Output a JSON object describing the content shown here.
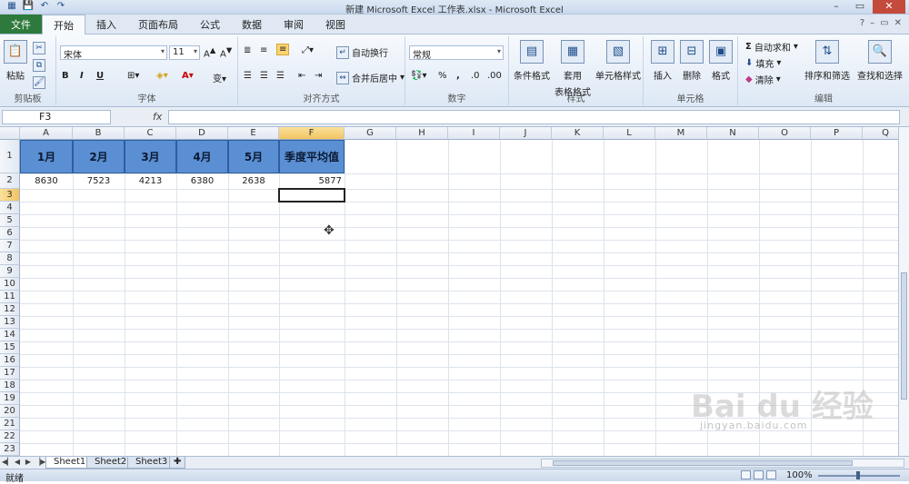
{
  "window": {
    "title": "新建 Microsoft Excel 工作表.xlsx - Microsoft Excel"
  },
  "ribbon_tabs": [
    "文件",
    "开始",
    "插入",
    "页面布局",
    "公式",
    "数据",
    "审阅",
    "视图"
  ],
  "clipboard": {
    "paste": "粘贴",
    "group": "剪贴板"
  },
  "font": {
    "name": "宋体",
    "size": "11",
    "bold": "B",
    "italic": "I",
    "underline": "U",
    "group": "字体"
  },
  "alignment": {
    "wrap": "自动换行",
    "merge": "合并后居中",
    "group": "对齐方式"
  },
  "number": {
    "format": "常规",
    "percent": "%",
    "comma": ",",
    "group": "数字"
  },
  "styles": {
    "conditional": "条件格式",
    "table1": "套用",
    "table2": "表格格式",
    "cell_styles": "单元格样式",
    "group": "样式"
  },
  "cells_grp": {
    "insert": "插入",
    "delete": "删除",
    "format": "格式",
    "group": "单元格"
  },
  "editing": {
    "autosum": "自动求和",
    "fill": "填充",
    "clear": "清除",
    "sort": "排序和筛选",
    "find": "查找和选择",
    "group": "编辑"
  },
  "formula_bar": {
    "name_box": "F3",
    "fx": "fx",
    "content": ""
  },
  "columns": [
    "A",
    "B",
    "C",
    "D",
    "E",
    "F",
    "G",
    "H",
    "I",
    "J",
    "K",
    "L",
    "M",
    "N",
    "O",
    "P",
    "Q"
  ],
  "rows": [
    "1",
    "2",
    "3",
    "4",
    "5",
    "6",
    "7",
    "8",
    "9",
    "10",
    "11",
    "12",
    "13",
    "14",
    "15",
    "16",
    "17",
    "18",
    "19",
    "20",
    "21",
    "22",
    "23"
  ],
  "table": {
    "headers": [
      "1月",
      "2月",
      "3月",
      "4月",
      "5月",
      "季度平均值"
    ],
    "values": [
      "8630",
      "7523",
      "4213",
      "6380",
      "2638",
      "5877"
    ]
  },
  "sheets": [
    "Sheet1",
    "Sheet2",
    "Sheet3"
  ],
  "status": {
    "ready": "就绪",
    "zoom": "100%"
  },
  "watermark": {
    "main": "Bai du 经验",
    "sub": "jingyan.baidu.com"
  }
}
